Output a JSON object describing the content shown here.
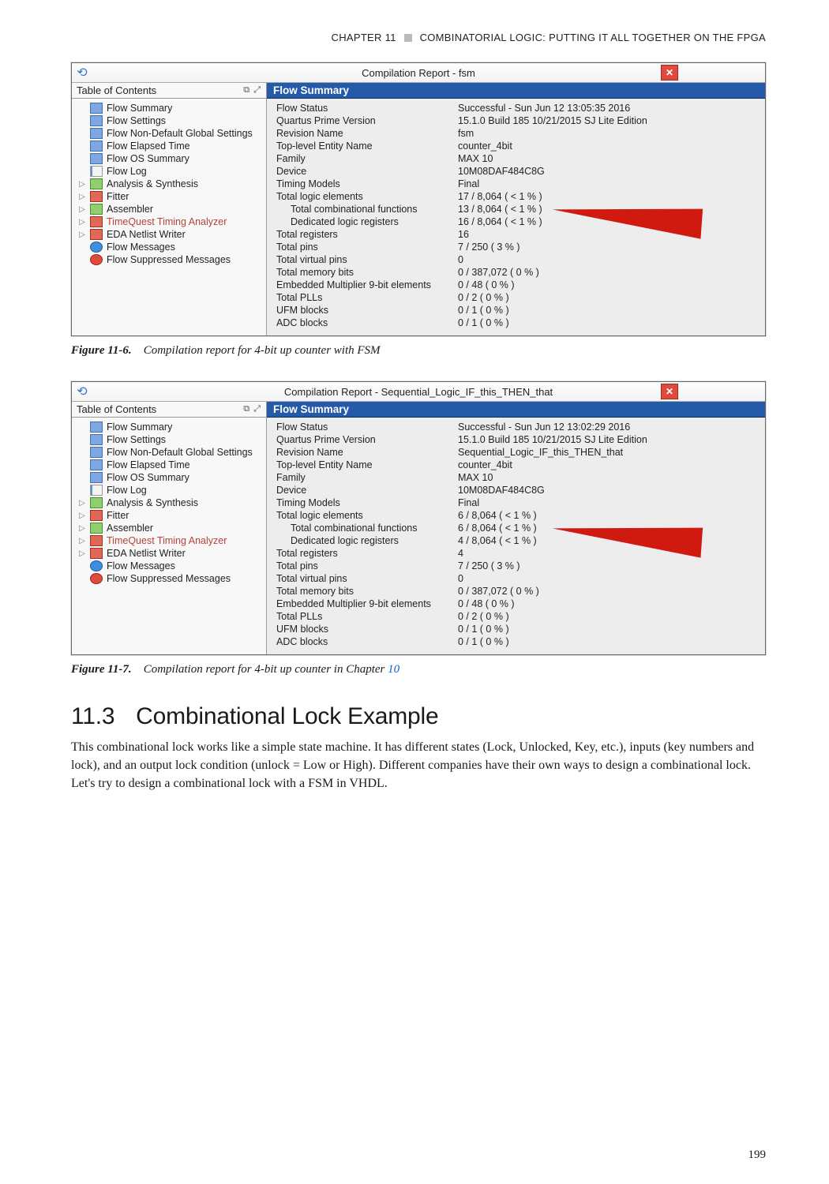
{
  "runningHead": {
    "chapter": "CHAPTER 11",
    "title": "COMBINATORIAL LOGIC: PUTTING IT ALL TOGETHER ON THE FPGA"
  },
  "figureA": {
    "windowTitle": "Compilation Report - fsm",
    "tocTitle": "Table of Contents",
    "panelTitle": "Flow Summary",
    "toc": [
      {
        "arrow": "none",
        "icon": "table",
        "label": "Flow Summary"
      },
      {
        "arrow": "none",
        "icon": "table",
        "label": "Flow Settings"
      },
      {
        "arrow": "none",
        "icon": "table",
        "label": "Flow Non-Default Global Settings"
      },
      {
        "arrow": "none",
        "icon": "table",
        "label": "Flow Elapsed Time"
      },
      {
        "arrow": "none",
        "icon": "table",
        "label": "Flow OS Summary"
      },
      {
        "arrow": "none",
        "icon": "sheet",
        "label": "Flow Log"
      },
      {
        "arrow": "tri",
        "icon": "folder-g",
        "label": "Analysis & Synthesis"
      },
      {
        "arrow": "tri",
        "icon": "folder-r",
        "label": "Fitter"
      },
      {
        "arrow": "tri",
        "icon": "folder-g",
        "label": "Assembler"
      },
      {
        "arrow": "tri",
        "icon": "folder-r",
        "label": "TimeQuest Timing Analyzer",
        "sel": true
      },
      {
        "arrow": "tri",
        "icon": "folder-r",
        "label": "EDA Netlist Writer"
      },
      {
        "arrow": "none",
        "icon": "circle-b",
        "label": "Flow Messages"
      },
      {
        "arrow": "none",
        "icon": "circle-r",
        "label": "Flow Suppressed Messages"
      }
    ],
    "summary": [
      {
        "k": "Flow Status",
        "v": "Successful - Sun Jun 12 13:05:35 2016"
      },
      {
        "k": "Quartus Prime Version",
        "v": "15.1.0 Build 185 10/21/2015 SJ Lite Edition"
      },
      {
        "k": "Revision Name",
        "v": "fsm"
      },
      {
        "k": "Top-level Entity Name",
        "v": "counter_4bit"
      },
      {
        "k": "Family",
        "v": "MAX 10"
      },
      {
        "k": "Device",
        "v": "10M08DAF484C8G"
      },
      {
        "k": "Timing Models",
        "v": "Final"
      },
      {
        "k": "Total logic elements",
        "v": "17 / 8,064 ( < 1 % )"
      },
      {
        "k": "Total combinational functions",
        "indent": true,
        "v": "13 / 8,064 ( < 1 % )"
      },
      {
        "k": "Dedicated logic registers",
        "indent": true,
        "v": "16 / 8,064 ( < 1 % )"
      },
      {
        "k": "Total registers",
        "v": "16"
      },
      {
        "k": "Total pins",
        "v": "7 / 250 ( 3 % )"
      },
      {
        "k": "Total virtual pins",
        "v": "0"
      },
      {
        "k": "Total memory bits",
        "v": "0 / 387,072 ( 0 % )"
      },
      {
        "k": "Embedded Multiplier 9-bit elements",
        "v": "0 / 48 ( 0 % )"
      },
      {
        "k": "Total PLLs",
        "v": "0 / 2 ( 0 % )"
      },
      {
        "k": "UFM blocks",
        "v": "0 / 1 ( 0 % )"
      },
      {
        "k": "ADC blocks",
        "v": "0 / 1 ( 0 % )"
      }
    ],
    "caption": {
      "label": "Figure 11-6.",
      "text": "Compilation report for 4-bit up counter with FSM"
    }
  },
  "figureB": {
    "windowTitle": "Compilation Report - Sequential_Logic_IF_this_THEN_that",
    "tocTitle": "Table of Contents",
    "panelTitle": "Flow Summary",
    "toc": [
      {
        "arrow": "none",
        "icon": "table",
        "label": "Flow Summary"
      },
      {
        "arrow": "none",
        "icon": "table",
        "label": "Flow Settings"
      },
      {
        "arrow": "none",
        "icon": "table",
        "label": "Flow Non-Default Global Settings"
      },
      {
        "arrow": "none",
        "icon": "table",
        "label": "Flow Elapsed Time"
      },
      {
        "arrow": "none",
        "icon": "table",
        "label": "Flow OS Summary"
      },
      {
        "arrow": "none",
        "icon": "sheet",
        "label": "Flow Log"
      },
      {
        "arrow": "tri",
        "icon": "folder-g",
        "label": "Analysis & Synthesis"
      },
      {
        "arrow": "tri",
        "icon": "folder-r",
        "label": "Fitter"
      },
      {
        "arrow": "tri",
        "icon": "folder-g",
        "label": "Assembler"
      },
      {
        "arrow": "tri",
        "icon": "folder-r",
        "label": "TimeQuest Timing Analyzer",
        "sel": true
      },
      {
        "arrow": "tri",
        "icon": "folder-r",
        "label": "EDA Netlist Writer"
      },
      {
        "arrow": "none",
        "icon": "circle-b",
        "label": "Flow Messages"
      },
      {
        "arrow": "none",
        "icon": "circle-r",
        "label": "Flow Suppressed Messages"
      }
    ],
    "summary": [
      {
        "k": "Flow Status",
        "v": "Successful - Sun Jun 12 13:02:29 2016"
      },
      {
        "k": "Quartus Prime Version",
        "v": "15.1.0 Build 185 10/21/2015 SJ Lite Edition"
      },
      {
        "k": "Revision Name",
        "v": "Sequential_Logic_IF_this_THEN_that"
      },
      {
        "k": "Top-level Entity Name",
        "v": "counter_4bit"
      },
      {
        "k": "Family",
        "v": "MAX 10"
      },
      {
        "k": "Device",
        "v": "10M08DAF484C8G"
      },
      {
        "k": "Timing Models",
        "v": "Final"
      },
      {
        "k": "Total logic elements",
        "v": "6 / 8,064 ( < 1 % )"
      },
      {
        "k": "Total combinational functions",
        "indent": true,
        "v": "6 / 8,064 ( < 1 % )"
      },
      {
        "k": "Dedicated logic registers",
        "indent": true,
        "v": "4 / 8,064 ( < 1 % )"
      },
      {
        "k": "Total registers",
        "v": "4"
      },
      {
        "k": "Total pins",
        "v": "7 / 250 ( 3 % )"
      },
      {
        "k": "Total virtual pins",
        "v": "0"
      },
      {
        "k": "Total memory bits",
        "v": "0 / 387,072 ( 0 % )"
      },
      {
        "k": "Embedded Multiplier 9-bit elements",
        "v": "0 / 48 ( 0 % )"
      },
      {
        "k": "Total PLLs",
        "v": "0 / 2 ( 0 % )"
      },
      {
        "k": "UFM blocks",
        "v": "0 / 1 ( 0 % )"
      },
      {
        "k": "ADC blocks",
        "v": "0 / 1 ( 0 % )"
      }
    ],
    "caption": {
      "label": "Figure 11-7.",
      "text": "Compilation report for 4-bit up counter in Chapter ",
      "link": "10"
    }
  },
  "section": {
    "num": "11.3",
    "title": "Combinational Lock Example"
  },
  "bodyText": "This combinational lock works like a simple state machine. It has different states (Lock, Unlocked, Key, etc.), inputs (key numbers and lock), and an output lock condition (unlock = Low or High). Different companies have their own ways to design a combinational lock. Let's try to design a combinational lock with a FSM in VHDL.",
  "pageNumber": "199"
}
